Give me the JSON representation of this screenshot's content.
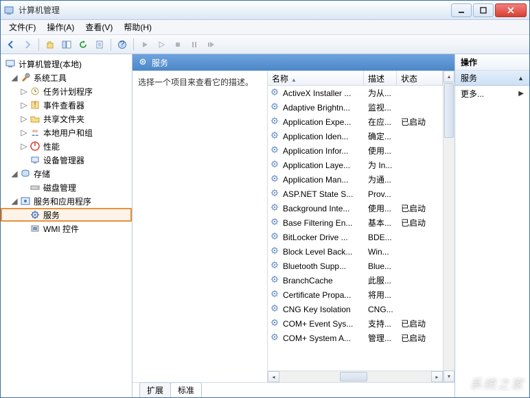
{
  "window": {
    "title": "计算机管理"
  },
  "menu": {
    "file": "文件(F)",
    "action": "操作(A)",
    "view": "查看(V)",
    "help": "帮助(H)"
  },
  "tree": {
    "root": "计算机管理(本地)",
    "systools": "系统工具",
    "taskscheduler": "任务计划程序",
    "eventviewer": "事件查看器",
    "sharedfolders": "共享文件夹",
    "localusers": "本地用户和组",
    "performance": "性能",
    "devicemgr": "设备管理器",
    "storage": "存储",
    "diskmgmt": "磁盘管理",
    "servicesapps": "服务和应用程序",
    "services": "服务",
    "wmi": "WMI 控件"
  },
  "mid": {
    "title": "服务",
    "hint": "选择一个项目来查看它的描述。",
    "cols": {
      "name": "名称",
      "desc": "描述",
      "status": "状态"
    },
    "tab_ext": "扩展",
    "tab_std": "标准"
  },
  "services": [
    {
      "name": "ActiveX Installer ...",
      "desc": "为从...",
      "status": ""
    },
    {
      "name": "Adaptive Brightn...",
      "desc": "监视...",
      "status": ""
    },
    {
      "name": "Application Expe...",
      "desc": "在应...",
      "status": "已启动"
    },
    {
      "name": "Application Iden...",
      "desc": "确定...",
      "status": ""
    },
    {
      "name": "Application Infor...",
      "desc": "使用...",
      "status": ""
    },
    {
      "name": "Application Laye...",
      "desc": "为 In...",
      "status": ""
    },
    {
      "name": "Application Man...",
      "desc": "为通...",
      "status": ""
    },
    {
      "name": "ASP.NET State S...",
      "desc": "Prov...",
      "status": ""
    },
    {
      "name": "Background Inte...",
      "desc": "使用...",
      "status": "已启动"
    },
    {
      "name": "Base Filtering En...",
      "desc": "基本...",
      "status": "已启动"
    },
    {
      "name": "BitLocker Drive ...",
      "desc": "BDE...",
      "status": ""
    },
    {
      "name": "Block Level Back...",
      "desc": "Win...",
      "status": ""
    },
    {
      "name": "Bluetooth Supp...",
      "desc": "Blue...",
      "status": ""
    },
    {
      "name": "BranchCache",
      "desc": "此服...",
      "status": ""
    },
    {
      "name": "Certificate Propa...",
      "desc": "将用...",
      "status": ""
    },
    {
      "name": "CNG Key Isolation",
      "desc": "CNG...",
      "status": ""
    },
    {
      "name": "COM+ Event Sys...",
      "desc": "支持...",
      "status": "已启动"
    },
    {
      "name": "COM+ System A...",
      "desc": "管理...",
      "status": "已启动"
    }
  ],
  "actions": {
    "header": "操作",
    "services": "服务",
    "more": "更多..."
  },
  "watermark": "系统之家"
}
